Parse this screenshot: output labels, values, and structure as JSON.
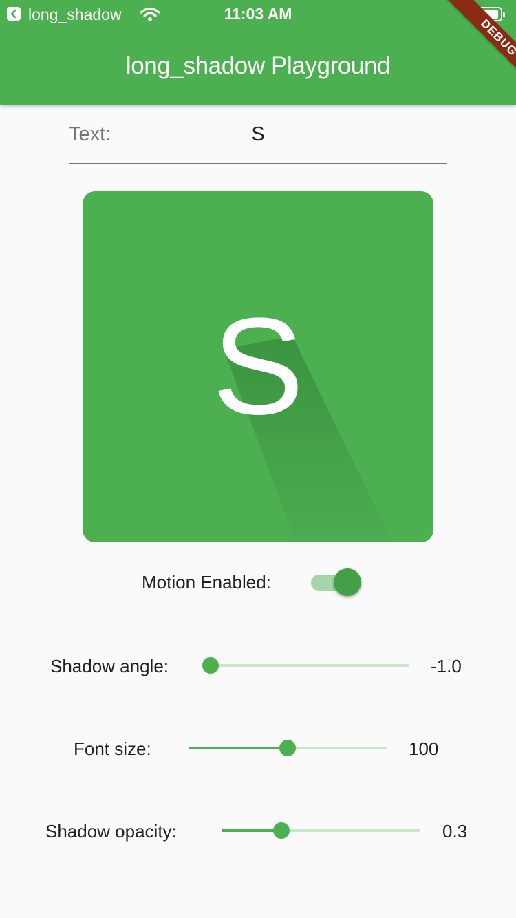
{
  "status_bar": {
    "carrier": "long_shadow",
    "time": "11:03 AM"
  },
  "app_bar": {
    "title": "long_shadow Playground",
    "debug_banner": "DEBUG",
    "color": "#4caf50"
  },
  "text_field": {
    "label": "Text:",
    "value": "S"
  },
  "preview": {
    "letter": "S"
  },
  "motion": {
    "label": "Motion Enabled:",
    "enabled": true
  },
  "sliders": [
    {
      "label": "Shadow angle:",
      "value_text": "-1.0",
      "fraction": 0.0
    },
    {
      "label": "Font size:",
      "value_text": "100",
      "fraction": 0.5
    },
    {
      "label": "Shadow opacity:",
      "value_text": "0.3",
      "fraction": 0.3
    }
  ]
}
